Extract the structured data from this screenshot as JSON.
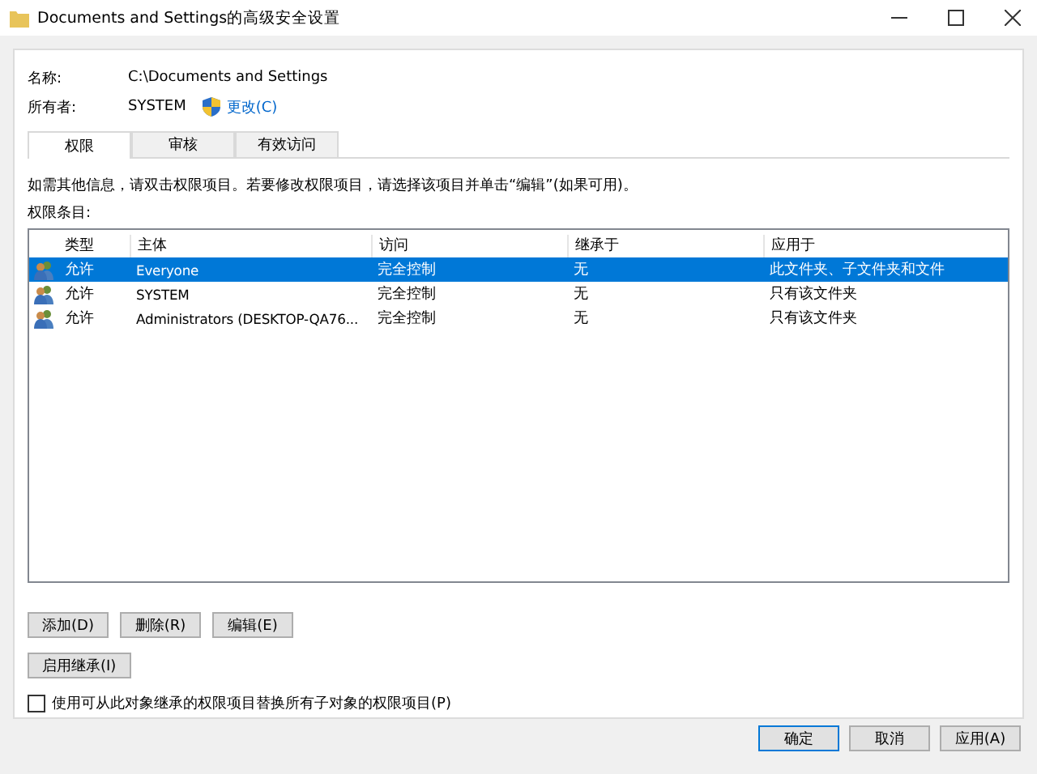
{
  "window": {
    "title": "Documents and Settings的高级安全设置"
  },
  "name": {
    "label": "名称:",
    "value": "C:\\Documents and Settings"
  },
  "owner": {
    "label": "所有者:",
    "value": "SYSTEM",
    "change_link": "更改(C)"
  },
  "tabs": [
    {
      "label": "权限",
      "selected": true
    },
    {
      "label": "审核",
      "selected": false
    },
    {
      "label": "有效访问",
      "selected": false
    }
  ],
  "info_text": "如需其他信息，请双击权限项目。若要修改权限项目，请选择该项目并单击“编辑”(如果可用)。",
  "entries_label": "权限条目:",
  "table": {
    "columns": [
      "类型",
      "主体",
      "访问",
      "继承于",
      "应用于"
    ],
    "rows": [
      {
        "type": "允许",
        "principal": "Everyone",
        "access": "完全控制",
        "inherited_from": "无",
        "applies_to": "此文件夹、子文件夹和文件",
        "selected": true
      },
      {
        "type": "允许",
        "principal": "SYSTEM",
        "access": "完全控制",
        "inherited_from": "无",
        "applies_to": "只有该文件夹",
        "selected": false
      },
      {
        "type": "允许",
        "principal": "Administrators (DESKTOP-QA76...",
        "access": "完全控制",
        "inherited_from": "无",
        "applies_to": "只有该文件夹",
        "selected": false
      }
    ]
  },
  "entry_buttons": [
    "添加(D)",
    "删除(R)",
    "编辑(E)"
  ],
  "inherit_button": "启用继承(I)",
  "replace_checkbox": {
    "label": "使用可从此对象继承的权限项目替换所有子对象的权限项目(P)",
    "checked": false
  },
  "dialog_buttons": [
    "确定",
    "取消",
    "应用(A)"
  ]
}
